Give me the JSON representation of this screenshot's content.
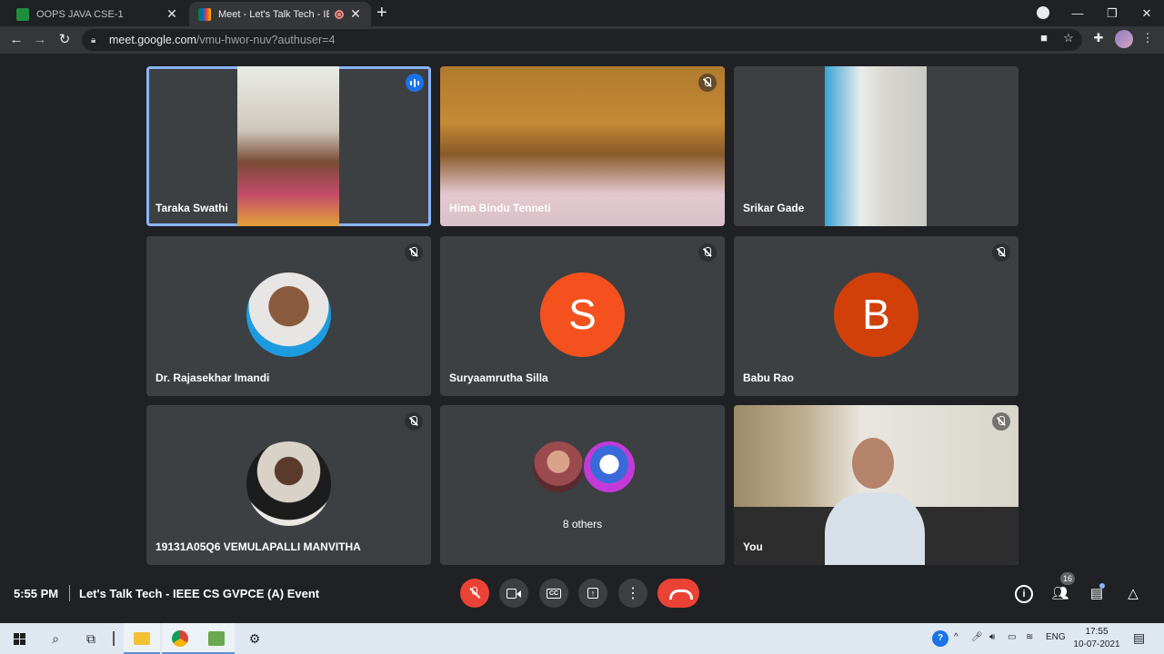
{
  "browser": {
    "tabs": [
      {
        "label": "OOPS JAVA CSE-1",
        "active": false
      },
      {
        "label": "Meet - Let's Talk Tech - IEEE C",
        "active": true
      }
    ],
    "url_host": "meet.google.com",
    "url_path": "/vmu-hwor-nuv?authuser=4"
  },
  "tiles": [
    {
      "name": "Taraka Swathi",
      "state": "speaking"
    },
    {
      "name": "Hima Bindu Tenneti",
      "state": "muted"
    },
    {
      "name": "Srikar Gade",
      "state": "video"
    },
    {
      "name": "Dr. Rajasekhar Imandi",
      "state": "muted"
    },
    {
      "name": "Suryaamrutha Silla",
      "state": "muted",
      "initial": "S",
      "color": "#f4511e"
    },
    {
      "name": "Babu Rao",
      "state": "muted",
      "initial": "B",
      "color": "#d2400a"
    },
    {
      "name": "19131A05Q6 VEMULAPALLI MANVITHA",
      "state": "muted"
    },
    {
      "others": "8 others"
    },
    {
      "name": "You",
      "state": "muted"
    }
  ],
  "meeting": {
    "time": "5:55 PM",
    "title": "Let's Talk Tech - IEEE CS GVPCE (A) Event",
    "participants_count": "16"
  },
  "taskbar": {
    "lang": "ENG",
    "time": "17:55",
    "date": "10-07-2021"
  },
  "colors": {
    "accent_blue": "#8ab4f8",
    "end_call_red": "#ea4335",
    "tile_bg": "#3c4043"
  }
}
